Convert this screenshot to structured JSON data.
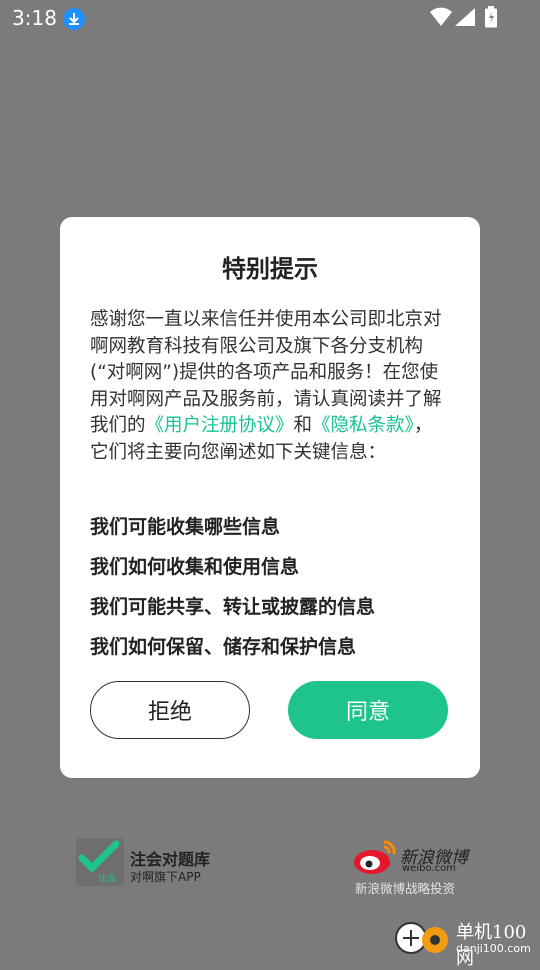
{
  "status": {
    "time": "3:18"
  },
  "dialog": {
    "title": "特别提示",
    "body_lines": {
      "p1": "感谢您一直以来信任并使用本公司即北京对啊网教育科技有限公司及旗下各分支机构(“对啊网”)提供的各项产品和服务！在您使用对啊网产品及服务前，请认真阅读并了解我们的",
      "link1": "《用户注册协议》",
      "and": "和",
      "link2": "《隐私条款》",
      "p2": "，它们将主要向您阐述如下关键信息："
    },
    "items": [
      "我们可能收集哪些信息",
      "我们如何收集和使用信息",
      "我们可能共享、转让或披露的信息",
      "我们如何保留、储存和保护信息"
    ],
    "reject_label": "拒绝",
    "agree_label": "同意"
  },
  "footer": {
    "app_icon_label": "注会",
    "app_name": "注会对题库",
    "app_sub": "对啊旗下APP",
    "weibo_name": "新浪微博",
    "weibo_url": "weibo.com",
    "weibo_sub": "新浪微博战略投资"
  },
  "watermark": {
    "title": "单机100网",
    "url": "danji100.com"
  },
  "colors": {
    "accent": "#1ec48c",
    "link": "#18c58f",
    "overlay": "#7b7b7b"
  }
}
